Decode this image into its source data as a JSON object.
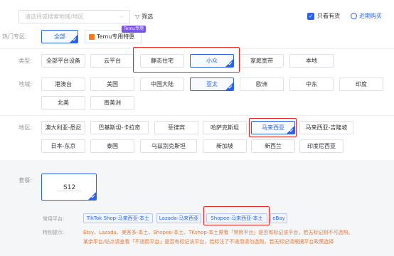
{
  "filterbar": {
    "search_placeholder": "请选择或搜索地域/地区",
    "filter_label": "筛选",
    "only_stock_label": "只看有货",
    "recent_label": "近期购买"
  },
  "hot": {
    "label": "热门专区:",
    "items": [
      "全部",
      "Temu专用特惠"
    ],
    "badge": "Temu专用"
  },
  "type": {
    "label": "类型:",
    "items": [
      "全部平台设备",
      "云平台",
      "静态住宅",
      "小众",
      "家庭宽带",
      "本地"
    ]
  },
  "region": {
    "label": "地域:",
    "row1": [
      "港澳台",
      "美国",
      "中国大陆",
      "亚太",
      "欧洲",
      "中东",
      "印度"
    ],
    "row2": [
      "北美",
      "南美洲"
    ]
  },
  "area": {
    "label": "地区:",
    "row1": [
      "澳大利亚-悉尼",
      "巴基斯坦-卡拉奇",
      "菲律宾",
      "哈萨克斯坦",
      "马来西亚",
      "马来西亚-吉隆坡"
    ],
    "row2": [
      "日本-东京",
      "泰国",
      "乌兹别克斯坦",
      "新加坡",
      "新西兰",
      "印度尼西亚"
    ]
  },
  "package": {
    "label": "套餐:",
    "card_name": "S12"
  },
  "platforms": {
    "label": "常用平台:",
    "items": [
      "TikTok Shop-马来西亚-本土",
      "Lazada-马来西亚",
      "Shopee-马来西亚-本土",
      "eBay"
    ]
  },
  "tips": {
    "label": "特别提示:",
    "line1": "Etsy、Lazada、美客多-本土、Shopee-本土、TKshop-本土需看「常用平台」是否有标记该平台，若无标记则不可选购。",
    "line2": "某余平台/站点请查看「不适用平台」是否有标记该平台，若标注了不适用请勿选购，若无标记请根据平台政策选择"
  },
  "colors": {
    "accent": "#2b63e6",
    "highlight": "#e8261f",
    "note": "#e07a3c"
  }
}
